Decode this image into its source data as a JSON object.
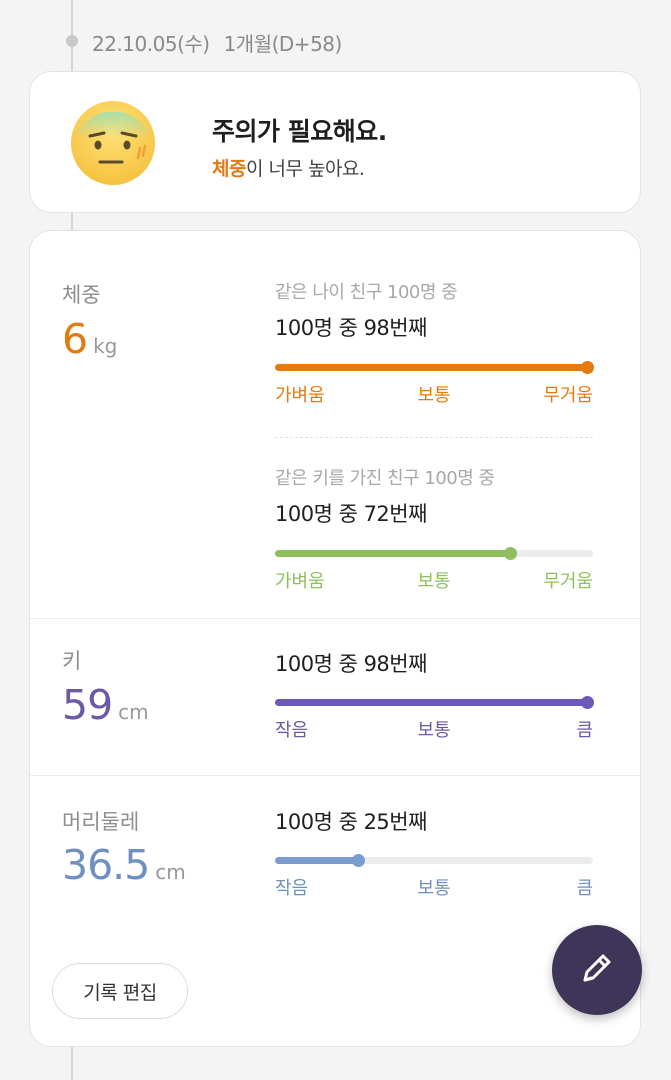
{
  "entry": {
    "date": "22.10.05(수)",
    "age": "1개월(D+58)"
  },
  "alert": {
    "title": "주의가 필요해요.",
    "highlight": "체중",
    "message": "이 너무 높아요.",
    "emoji_icon": "worried-face-icon"
  },
  "weight": {
    "label": "체중",
    "value": "6",
    "unit": "kg",
    "color": "#e07a12",
    "by_age": {
      "caption": "같은 나이 친구 100명 중",
      "rank": "100명 중 98번째",
      "percentile": 0.98,
      "color": "#e57a10",
      "scale": [
        "가벼움",
        "보통",
        "무거움"
      ]
    },
    "by_height": {
      "caption": "같은 키를 가진 친구 100명 중",
      "rank": "100명 중 72번째",
      "percentile": 0.74,
      "color": "#8fbf5c",
      "scale": [
        "가벼움",
        "보통",
        "무거움"
      ]
    }
  },
  "height": {
    "label": "키",
    "value": "59",
    "unit": "cm",
    "color": "#6c59a6",
    "rank": "100명 중 98번째",
    "percentile": 0.98,
    "bar_color": "#6c59b8",
    "scale": [
      "작음",
      "보통",
      "큼"
    ]
  },
  "head": {
    "label": "머리둘레",
    "value": "36.5",
    "unit": "cm",
    "color": "#6f8fbf",
    "rank": "100명 중 25번째",
    "percentile": 0.26,
    "bar_color": "#7b9ccf",
    "scale": [
      "작음",
      "보통",
      "큼"
    ]
  },
  "actions": {
    "edit_label": "기록 편집",
    "fab_icon": "pencil-icon"
  }
}
